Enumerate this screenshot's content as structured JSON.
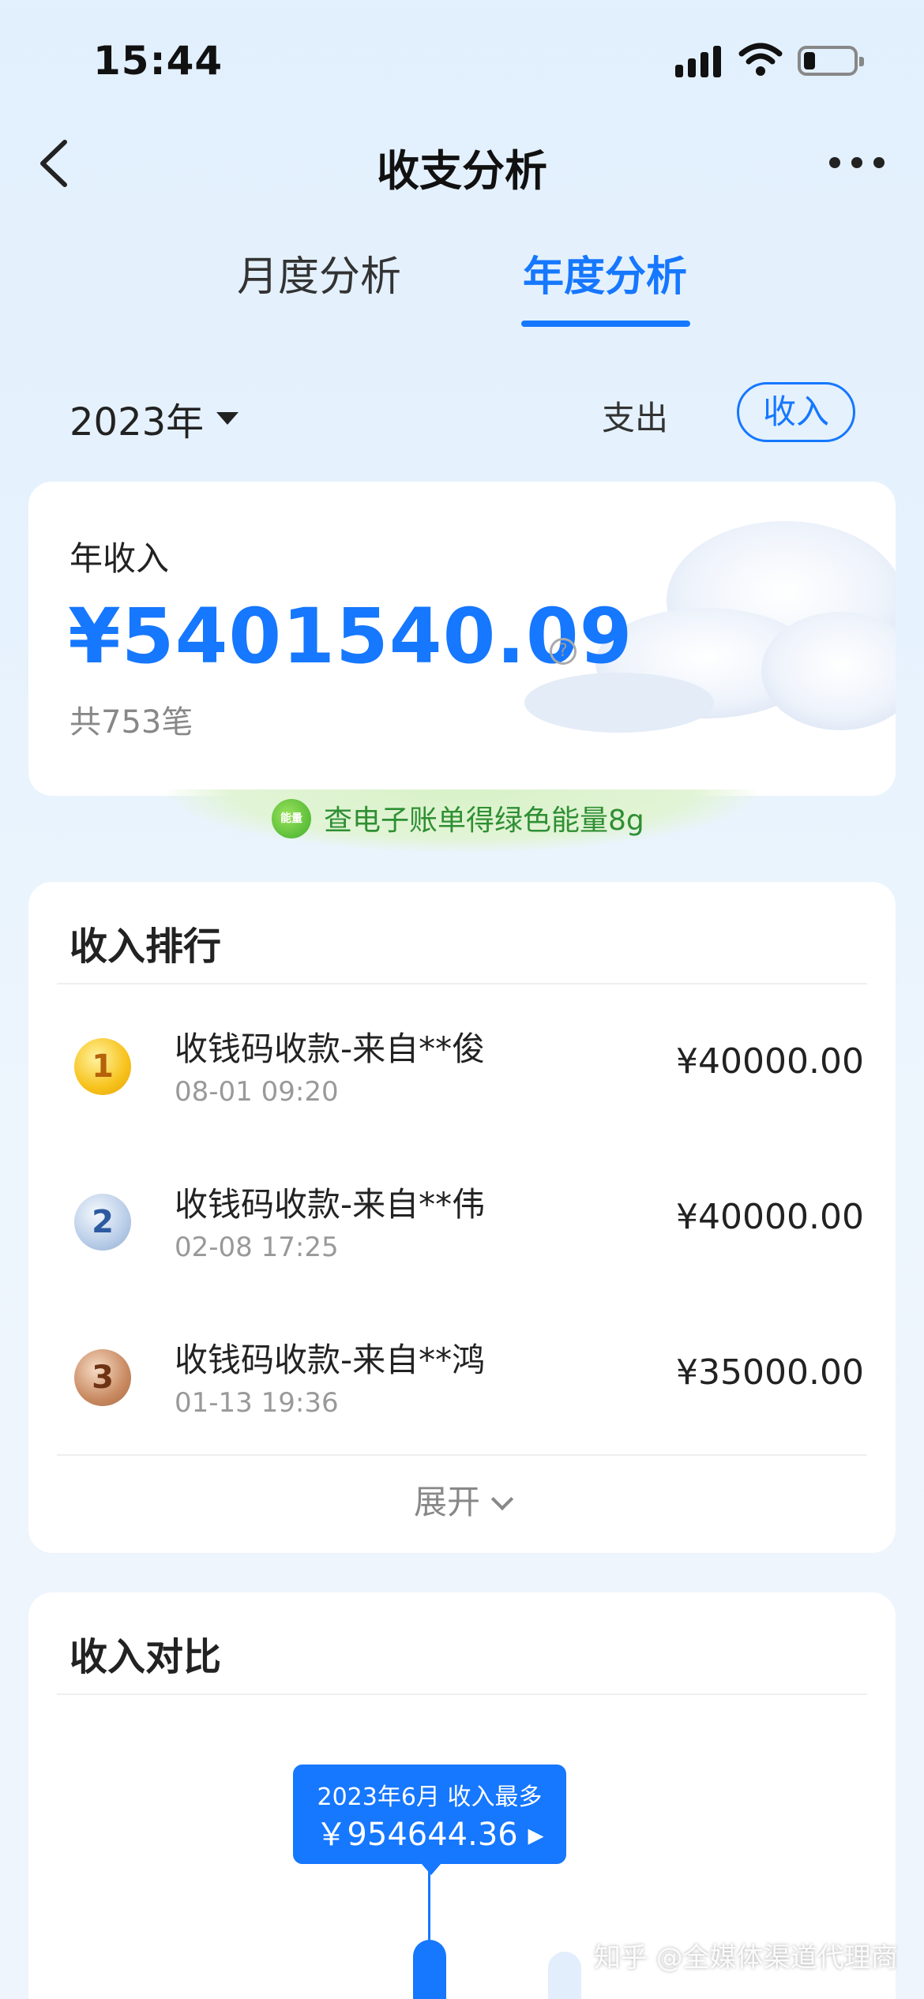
{
  "status_bar": {
    "time": "15:44"
  },
  "nav": {
    "title": "收支分析"
  },
  "tabs": [
    {
      "label": "月度分析",
      "active": false
    },
    {
      "label": "年度分析",
      "active": true
    }
  ],
  "filters": {
    "year": "2023年",
    "expense_label": "支出",
    "income_label": "收入",
    "selected": "收入"
  },
  "summary": {
    "label": "年收入",
    "amount": "¥5401540.09",
    "count": "共753笔"
  },
  "energy_banner": {
    "icon_text": "能量",
    "text": "查电子账单得绿色能量8g"
  },
  "ranking": {
    "title": "收入排行",
    "items": [
      {
        "rank": "1",
        "name": "收钱码收款-来自**俊",
        "time": "08-01 09:20",
        "amount": "¥40000.00"
      },
      {
        "rank": "2",
        "name": "收钱码收款-来自**伟",
        "time": "02-08 17:25",
        "amount": "¥40000.00"
      },
      {
        "rank": "3",
        "name": "收钱码收款-来自**鸿",
        "time": "01-13 19:36",
        "amount": "¥35000.00"
      }
    ],
    "expand_label": "展开"
  },
  "comparison": {
    "title": "收入对比",
    "tooltip_line1": "2023年6月 收入最多",
    "tooltip_line2": "￥954644.36 ▸"
  },
  "watermark": "知乎 @全媒体渠道代理商",
  "colors": {
    "accent": "#1677ff",
    "energy_green": "#2f8f33"
  }
}
